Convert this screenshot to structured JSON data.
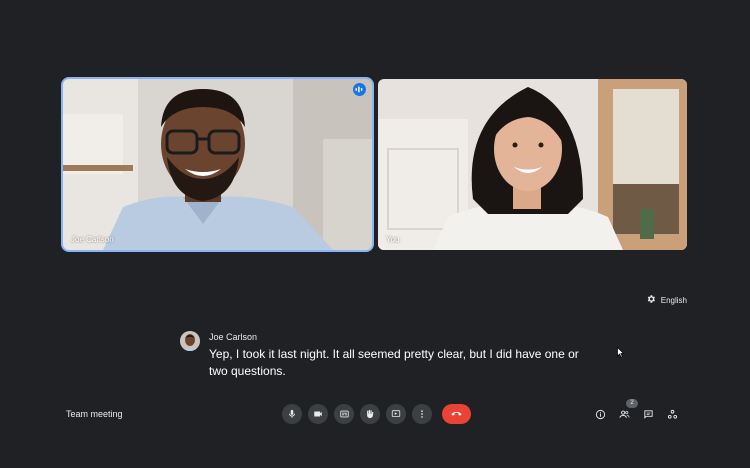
{
  "tiles": [
    {
      "name": "Joe Carlson",
      "speaking_indicator": "audio-wave-icon"
    },
    {
      "name": "You"
    }
  ],
  "language": {
    "label": "English",
    "icon": "settings-icon"
  },
  "caption": {
    "speaker": "Joe Carlson",
    "text": "Yep, I took it last night. It all seemed pretty clear, but I did have one or two questions."
  },
  "bottom_bar": {
    "meeting_name": "Team meeting",
    "controls": [
      "microphone-icon",
      "camera-icon",
      "captions-icon",
      "raise-hand-icon",
      "present-icon",
      "more-options-icon",
      "end-call-icon"
    ],
    "right_tools": [
      "info-icon",
      "people-icon",
      "chat-icon",
      "activities-icon"
    ],
    "people_count": "2"
  },
  "colors": {
    "background": "#202124",
    "active_border": "#8ab4f8",
    "end_call": "#ea4335",
    "button": "#3c4043",
    "speaking_badge": "#1a73e8"
  }
}
